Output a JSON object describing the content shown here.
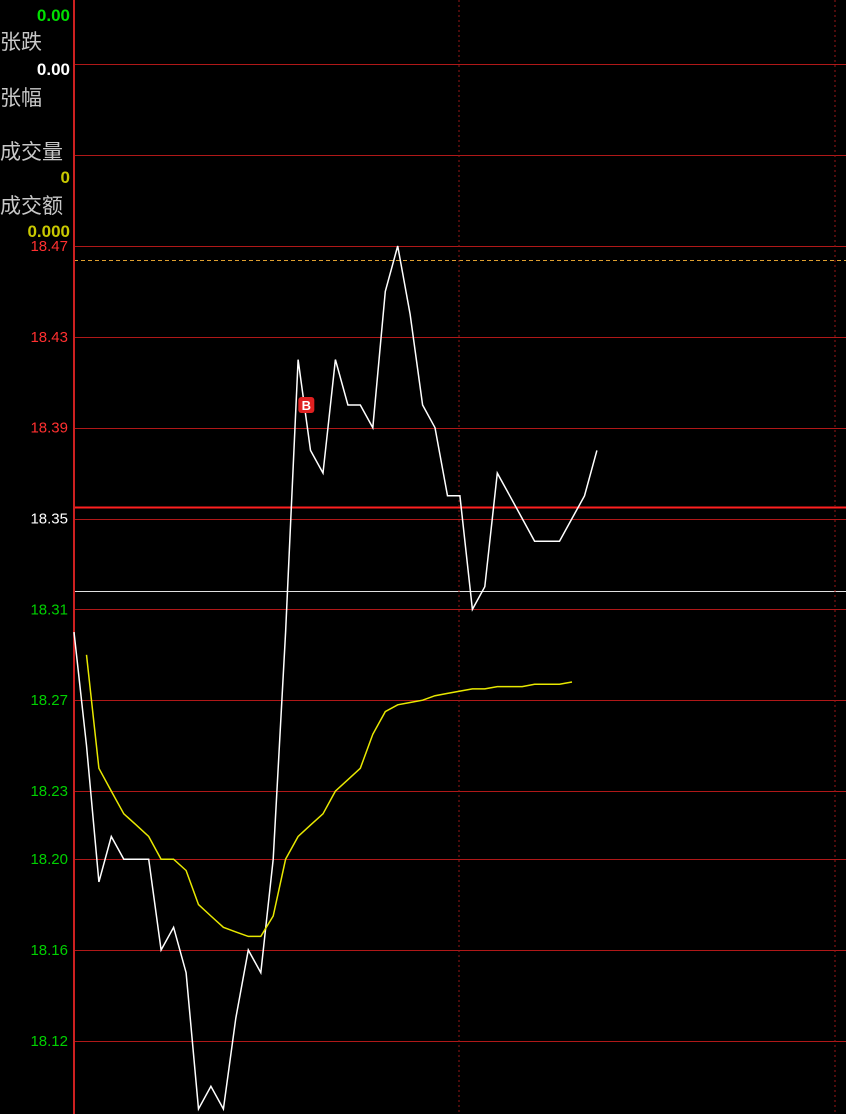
{
  "info_panel": {
    "items": [
      {
        "label": "",
        "value": "0.00",
        "value_color": "#00e000"
      },
      {
        "label": "张跌",
        "value": "0.00",
        "value_color": "#ffffff"
      },
      {
        "label": "张幅",
        "value": "",
        "value_color": "#ffffff"
      },
      {
        "label": "成交量",
        "value": "0",
        "value_color": "#c8c800"
      },
      {
        "label": "成交额",
        "value": "0.000",
        "value_color": "#c8c800"
      }
    ]
  },
  "chart_data": {
    "type": "line",
    "title": "",
    "xlabel": "",
    "ylabel": "",
    "ylim": [
      18.09,
      18.47
    ],
    "y_ticks": [
      {
        "value": 18.47,
        "label": "18.47",
        "color": "#ff3030"
      },
      {
        "value": 18.43,
        "label": "18.43",
        "color": "#ff3030"
      },
      {
        "value": 18.39,
        "label": "18.39",
        "color": "#ff3030"
      },
      {
        "value": 18.35,
        "label": "18.35",
        "color": "#ffffff"
      },
      {
        "value": 18.31,
        "label": "18.31",
        "color": "#00d000"
      },
      {
        "value": 18.27,
        "label": "18.27",
        "color": "#00d000"
      },
      {
        "value": 18.23,
        "label": "18.23",
        "color": "#00d000"
      },
      {
        "value": 18.2,
        "label": "18.20",
        "color": "#00d000"
      },
      {
        "value": 18.16,
        "label": "18.16",
        "color": "#00d000"
      },
      {
        "value": 18.12,
        "label": "18.12",
        "color": "#00d000"
      }
    ],
    "extra_gridlines": [
      18.51,
      18.55
    ],
    "reference_lines": [
      {
        "value": 18.355,
        "style": "solid",
        "color": "#ff2020"
      },
      {
        "value": 18.318,
        "style": "solid",
        "color": "#e0e0e0"
      },
      {
        "value": 18.464,
        "style": "dashed",
        "color": "#e0a030"
      }
    ],
    "x": [
      0,
      1,
      2,
      3,
      4,
      5,
      6,
      7,
      8,
      9,
      10,
      11,
      12,
      13,
      14,
      15,
      16,
      17,
      18,
      19,
      20,
      21,
      22,
      23,
      24,
      25,
      26,
      27,
      28,
      29,
      30,
      31,
      32,
      33,
      34,
      35,
      36,
      37,
      38,
      39,
      40,
      41
    ],
    "series": [
      {
        "color": "#ffffff",
        "values": [
          18.3,
          18.25,
          18.19,
          18.21,
          18.2,
          18.2,
          18.2,
          18.16,
          18.17,
          18.15,
          18.09,
          18.1,
          18.09,
          18.13,
          18.16,
          18.15,
          18.2,
          18.3,
          18.42,
          18.38,
          18.37,
          18.42,
          18.4,
          18.4,
          18.39,
          18.45,
          18.47,
          18.44,
          18.4,
          18.39,
          18.36,
          18.36,
          18.31,
          18.32,
          18.37,
          18.36,
          18.35,
          18.34,
          18.34,
          18.34,
          18.35,
          18.36,
          18.38
        ]
      },
      {
        "color": "#e8e800",
        "values": [
          18.29,
          18.24,
          18.23,
          18.22,
          18.215,
          18.21,
          18.2,
          18.2,
          18.195,
          18.18,
          18.175,
          18.17,
          18.168,
          18.166,
          18.166,
          18.175,
          18.2,
          18.21,
          18.215,
          18.22,
          18.23,
          18.235,
          18.24,
          18.255,
          18.265,
          18.268,
          18.269,
          18.27,
          18.272,
          18.273,
          18.274,
          18.275,
          18.275,
          18.276,
          18.276,
          18.276,
          18.277,
          18.277,
          18.277,
          18.278
        ]
      }
    ],
    "markers": [
      {
        "x": 18.5,
        "value": 18.4,
        "label": "B",
        "color": "#e02020"
      }
    ],
    "grid": true
  }
}
